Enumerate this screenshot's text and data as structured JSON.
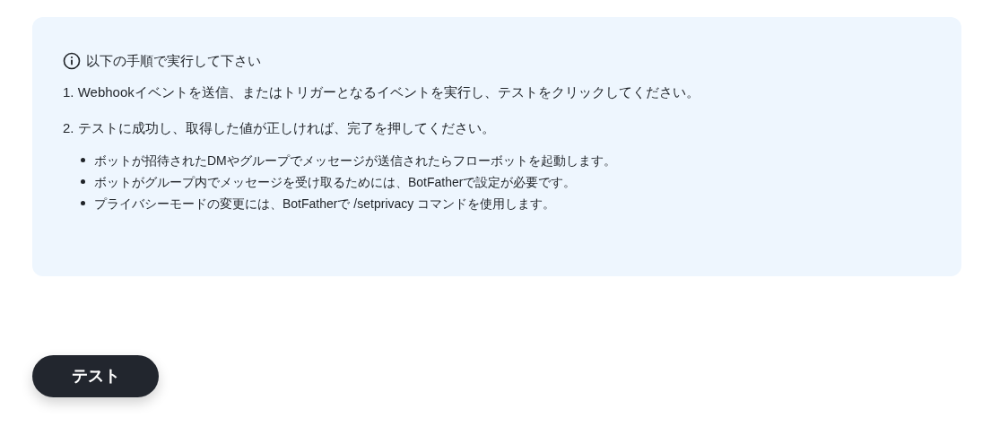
{
  "notice": {
    "title": "以下の手順で実行して下さい",
    "steps": [
      "1. Webhookイベントを送信、またはトリガーとなるイベントを実行し、テストをクリックしてください。",
      "2. テストに成功し、取得した値が正しければ、完了を押してください。"
    ],
    "notes": [
      "ボットが招待されたDMやグループでメッセージが送信されたらフローボットを起動します。",
      "ボットがグループ内でメッセージを受け取るためには、BotFatherで設定が必要です。",
      "プライバシーモードの変更には、BotFatherで /setprivacy コマンドを使用します。"
    ]
  },
  "button": {
    "label": "テスト"
  }
}
